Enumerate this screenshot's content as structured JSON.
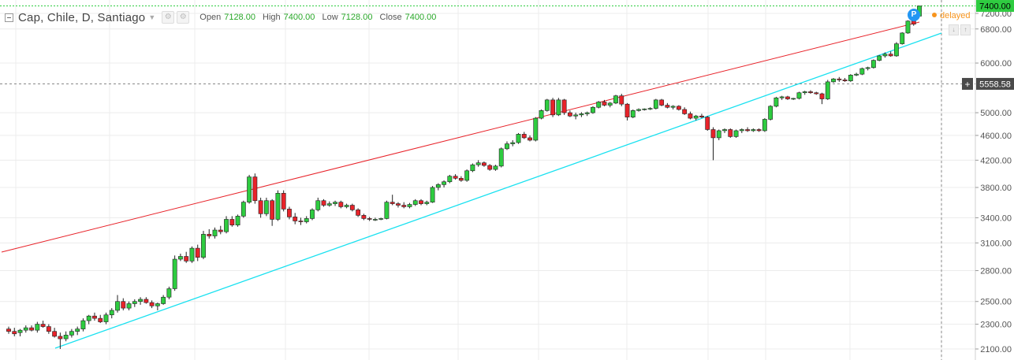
{
  "header": {
    "symbol": "Cap, Chile, D, Santiago",
    "open_label": "Open",
    "open_value": "7128.00",
    "high_label": "High",
    "high_value": "7400.00",
    "low_label": "Low",
    "low_value": "7128.00",
    "close_label": "Close",
    "close_value": "7400.00",
    "status": "delayed",
    "badge": "P"
  },
  "colors": {
    "up": "#2ecc40",
    "down": "#e8232a",
    "resistance": "#e8232a",
    "support": "#19e1f0",
    "last_price": "#2ecc40",
    "cursor_tag": "#4a4a4a"
  },
  "chart_data": {
    "type": "candlestick",
    "title": "Cap, Chile, D, Santiago",
    "y_scale": "log",
    "ylim": [
      2000,
      8000
    ],
    "y_ticks": [
      2100,
      2300,
      2500,
      2800,
      3100,
      3400,
      3800,
      4200,
      4600,
      5000,
      6000,
      6800,
      7200
    ],
    "y_tick_labels": [
      "2100.00",
      "2300.00",
      "2500.00",
      "2800.00",
      "3100.00",
      "3400.00",
      "3800.00",
      "4200.00",
      "4600.00",
      "5000.00",
      "6000.00",
      "6800.00",
      "7200.00"
    ],
    "last_price": 7400,
    "last_price_label": "7400.00",
    "cursor_price": 5558.58,
    "cursor_price_label": "5558.58",
    "candles": [
      [
        2260,
        2280,
        2220,
        2240
      ],
      [
        2240,
        2270,
        2200,
        2220
      ],
      [
        2230,
        2260,
        2200,
        2250
      ],
      [
        2250,
        2290,
        2230,
        2270
      ],
      [
        2270,
        2290,
        2240,
        2250
      ],
      [
        2250,
        2320,
        2230,
        2300
      ],
      [
        2300,
        2330,
        2270,
        2280
      ],
      [
        2280,
        2300,
        2220,
        2240
      ],
      [
        2240,
        2270,
        2190,
        2200
      ],
      [
        2200,
        2230,
        2100,
        2180
      ],
      [
        2180,
        2240,
        2160,
        2210
      ],
      [
        2210,
        2260,
        2190,
        2240
      ],
      [
        2240,
        2280,
        2210,
        2260
      ],
      [
        2260,
        2350,
        2240,
        2330
      ],
      [
        2330,
        2380,
        2300,
        2370
      ],
      [
        2370,
        2400,
        2330,
        2350
      ],
      [
        2350,
        2380,
        2310,
        2320
      ],
      [
        2320,
        2400,
        2300,
        2380
      ],
      [
        2380,
        2440,
        2350,
        2420
      ],
      [
        2420,
        2560,
        2400,
        2500
      ],
      [
        2500,
        2530,
        2420,
        2440
      ],
      [
        2440,
        2500,
        2420,
        2480
      ],
      [
        2480,
        2520,
        2450,
        2500
      ],
      [
        2500,
        2540,
        2470,
        2520
      ],
      [
        2520,
        2540,
        2480,
        2490
      ],
      [
        2490,
        2510,
        2440,
        2460
      ],
      [
        2460,
        2490,
        2420,
        2480
      ],
      [
        2480,
        2560,
        2470,
        2540
      ],
      [
        2540,
        2640,
        2520,
        2620
      ],
      [
        2620,
        2960,
        2600,
        2920
      ],
      [
        2920,
        2980,
        2900,
        2950
      ],
      [
        2950,
        3000,
        2880,
        2900
      ],
      [
        2900,
        3060,
        2880,
        3040
      ],
      [
        3040,
        3080,
        2900,
        2940
      ],
      [
        2940,
        3240,
        2920,
        3200
      ],
      [
        3200,
        3260,
        3150,
        3180
      ],
      [
        3180,
        3280,
        3150,
        3250
      ],
      [
        3250,
        3300,
        3200,
        3230
      ],
      [
        3230,
        3420,
        3210,
        3380
      ],
      [
        3380,
        3420,
        3290,
        3310
      ],
      [
        3310,
        3440,
        3290,
        3420
      ],
      [
        3420,
        3620,
        3400,
        3600
      ],
      [
        3600,
        3980,
        3580,
        3950
      ],
      [
        3950,
        4000,
        3580,
        3620
      ],
      [
        3620,
        3660,
        3400,
        3450
      ],
      [
        3450,
        3660,
        3420,
        3620
      ],
      [
        3620,
        3640,
        3300,
        3380
      ],
      [
        3380,
        3760,
        3360,
        3720
      ],
      [
        3720,
        3760,
        3480,
        3510
      ],
      [
        3510,
        3540,
        3380,
        3410
      ],
      [
        3410,
        3460,
        3320,
        3360
      ],
      [
        3360,
        3400,
        3310,
        3350
      ],
      [
        3350,
        3420,
        3330,
        3390
      ],
      [
        3390,
        3520,
        3370,
        3500
      ],
      [
        3500,
        3660,
        3480,
        3620
      ],
      [
        3620,
        3640,
        3540,
        3560
      ],
      [
        3560,
        3610,
        3540,
        3580
      ],
      [
        3580,
        3620,
        3550,
        3600
      ],
      [
        3600,
        3620,
        3520,
        3540
      ],
      [
        3540,
        3580,
        3520,
        3560
      ],
      [
        3560,
        3580,
        3480,
        3500
      ],
      [
        3500,
        3520,
        3410,
        3430
      ],
      [
        3430,
        3450,
        3370,
        3390
      ],
      [
        3390,
        3410,
        3360,
        3380
      ],
      [
        3380,
        3400,
        3360,
        3380
      ],
      [
        3380,
        3400,
        3370,
        3390
      ],
      [
        3390,
        3620,
        3380,
        3600
      ],
      [
        3600,
        3700,
        3560,
        3580
      ],
      [
        3580,
        3600,
        3530,
        3560
      ],
      [
        3560,
        3600,
        3520,
        3540
      ],
      [
        3540,
        3590,
        3520,
        3570
      ],
      [
        3570,
        3640,
        3550,
        3620
      ],
      [
        3620,
        3640,
        3560,
        3580
      ],
      [
        3580,
        3620,
        3560,
        3600
      ],
      [
        3600,
        3820,
        3590,
        3800
      ],
      [
        3800,
        3860,
        3760,
        3840
      ],
      [
        3840,
        3900,
        3800,
        3880
      ],
      [
        3880,
        3980,
        3860,
        3960
      ],
      [
        3960,
        3990,
        3910,
        3930
      ],
      [
        3930,
        3960,
        3880,
        3900
      ],
      [
        3900,
        4060,
        3880,
        4040
      ],
      [
        4040,
        4150,
        4020,
        4130
      ],
      [
        4130,
        4200,
        4100,
        4160
      ],
      [
        4160,
        4180,
        4100,
        4120
      ],
      [
        4120,
        4140,
        4040,
        4060
      ],
      [
        4060,
        4130,
        4040,
        4110
      ],
      [
        4110,
        4400,
        4090,
        4380
      ],
      [
        4380,
        4500,
        4360,
        4460
      ],
      [
        4460,
        4520,
        4420,
        4480
      ],
      [
        4480,
        4640,
        4460,
        4620
      ],
      [
        4620,
        4660,
        4540,
        4560
      ],
      [
        4560,
        4600,
        4500,
        4520
      ],
      [
        4520,
        4920,
        4500,
        4900
      ],
      [
        4900,
        5060,
        4880,
        5040
      ],
      [
        5040,
        5260,
        5020,
        5240
      ],
      [
        5240,
        5280,
        4920,
        4960
      ],
      [
        4960,
        5280,
        4940,
        5240
      ],
      [
        5240,
        5260,
        4960,
        5000
      ],
      [
        5000,
        5040,
        4920,
        4940
      ],
      [
        4940,
        5000,
        4880,
        4960
      ],
      [
        4960,
        5010,
        4920,
        4980
      ],
      [
        4980,
        5020,
        4940,
        5000
      ],
      [
        5000,
        5120,
        4980,
        5100
      ],
      [
        5100,
        5220,
        5080,
        5200
      ],
      [
        5200,
        5240,
        5120,
        5140
      ],
      [
        5140,
        5200,
        5100,
        5180
      ],
      [
        5180,
        5340,
        5160,
        5320
      ],
      [
        5320,
        5360,
        5120,
        5160
      ],
      [
        5160,
        5180,
        4860,
        4920
      ],
      [
        4920,
        5060,
        4900,
        5040
      ],
      [
        5040,
        5080,
        5020,
        5060
      ],
      [
        5060,
        5080,
        5040,
        5070
      ],
      [
        5070,
        5100,
        5050,
        5080
      ],
      [
        5080,
        5260,
        5060,
        5240
      ],
      [
        5240,
        5260,
        5120,
        5140
      ],
      [
        5140,
        5180,
        5080,
        5100
      ],
      [
        5100,
        5140,
        5060,
        5120
      ],
      [
        5120,
        5140,
        5040,
        5060
      ],
      [
        5060,
        5100,
        4960,
        4980
      ],
      [
        4980,
        5020,
        4880,
        4900
      ],
      [
        4900,
        4960,
        4860,
        4940
      ],
      [
        4940,
        4980,
        4900,
        4920
      ],
      [
        4920,
        4940,
        4680,
        4700
      ],
      [
        4700,
        4740,
        4200,
        4560
      ],
      [
        4560,
        4700,
        4520,
        4680
      ],
      [
        4680,
        4720,
        4640,
        4700
      ],
      [
        4700,
        4720,
        4560,
        4580
      ],
      [
        4580,
        4700,
        4560,
        4680
      ],
      [
        4680,
        4720,
        4640,
        4700
      ],
      [
        4700,
        4740,
        4660,
        4680
      ],
      [
        4680,
        4720,
        4660,
        4700
      ],
      [
        4700,
        4720,
        4660,
        4680
      ],
      [
        4680,
        4900,
        4660,
        4880
      ],
      [
        4880,
        5140,
        4860,
        5120
      ],
      [
        5120,
        5300,
        5100,
        5280
      ],
      [
        5280,
        5320,
        5240,
        5300
      ],
      [
        5300,
        5320,
        5240,
        5260
      ],
      [
        5260,
        5280,
        5240,
        5270
      ],
      [
        5270,
        5400,
        5250,
        5380
      ],
      [
        5380,
        5420,
        5340,
        5400
      ],
      [
        5400,
        5430,
        5360,
        5380
      ],
      [
        5380,
        5400,
        5340,
        5360
      ],
      [
        5360,
        5380,
        5160,
        5260
      ],
      [
        5260,
        5640,
        5240,
        5600
      ],
      [
        5600,
        5680,
        5580,
        5660
      ],
      [
        5660,
        5700,
        5600,
        5640
      ],
      [
        5640,
        5680,
        5600,
        5620
      ],
      [
        5620,
        5760,
        5600,
        5740
      ],
      [
        5740,
        5790,
        5720,
        5760
      ],
      [
        5760,
        5900,
        5740,
        5880
      ],
      [
        5880,
        5920,
        5840,
        5900
      ],
      [
        5900,
        6080,
        5880,
        6060
      ],
      [
        6060,
        6180,
        6040,
        6160
      ],
      [
        6160,
        6240,
        6120,
        6200
      ],
      [
        6200,
        6260,
        6140,
        6160
      ],
      [
        6160,
        6480,
        6140,
        6440
      ],
      [
        6440,
        6720,
        6420,
        6700
      ],
      [
        6700,
        7020,
        6680,
        7000
      ],
      [
        7000,
        7080,
        6880,
        6920
      ],
      [
        7128,
        7400,
        7128,
        7400
      ]
    ]
  }
}
